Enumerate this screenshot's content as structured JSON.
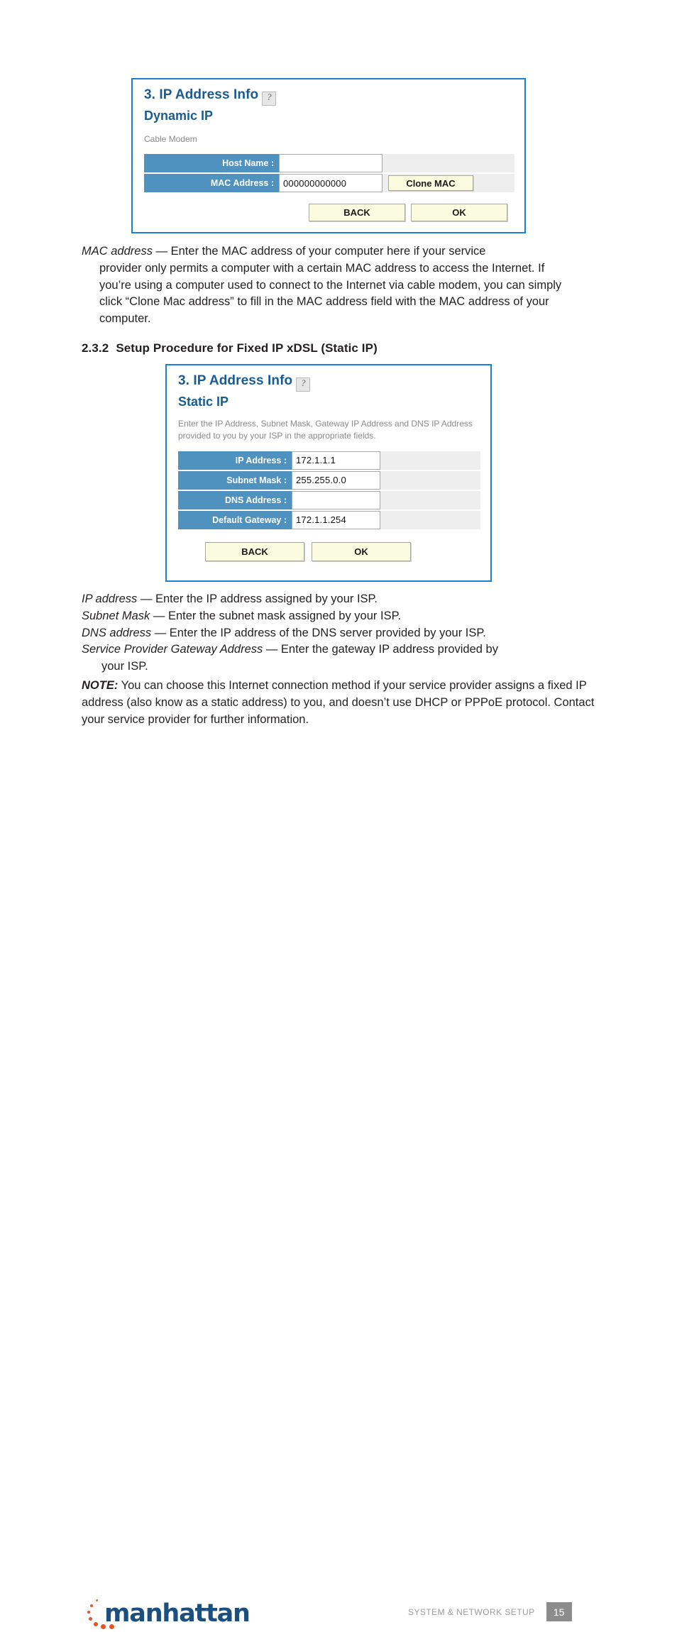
{
  "panels": [
    {
      "id": "dynamic",
      "title": "3. IP Address Info",
      "help_icon": "question-mark-icon",
      "subtitle": "Dynamic IP",
      "note": "Cable Modem",
      "rows": [
        {
          "label": "Host Name :",
          "value": "",
          "button": ""
        },
        {
          "label": "MAC Address :",
          "value": "000000000000",
          "button": "Clone MAC"
        }
      ],
      "actions": [
        "BACK",
        "OK"
      ]
    },
    {
      "id": "static",
      "title": "3. IP Address Info",
      "help_icon": "question-mark-icon",
      "subtitle": "Static IP",
      "note": "Enter the IP Address, Subnet Mask, Gateway IP Address and DNS IP Address provided to you by your ISP in the appropriate fields.",
      "rows": [
        {
          "label": "IP Address :",
          "value": "172.1.1.1"
        },
        {
          "label": "Subnet Mask :",
          "value": "255.255.0.0"
        },
        {
          "label": "DNS Address :",
          "value": ""
        },
        {
          "label": "Default Gateway :",
          "value": "172.1.1.254"
        }
      ],
      "actions": [
        "BACK",
        "OK"
      ]
    }
  ],
  "paragraph_mac": {
    "term": "MAC address",
    "dash": " — ",
    "line1": "Enter the MAC address of your computer here if your service",
    "rest": "provider only permits a computer with a certain MAC address to access the Internet. If you’re using a computer used to connect to the Internet via cable modem, you can simply click “Clone Mac address” to fill in the MAC address field with the MAC address of your computer."
  },
  "heading": {
    "number": "2.3.2",
    "text": "Setup Procedure for Fixed IP xDSL (Static IP)"
  },
  "definitions": [
    {
      "term": "IP address",
      "dash": " — ",
      "text": "Enter the IP address assigned by your ISP."
    },
    {
      "term": "Subnet Mask",
      "dash": " — ",
      "text": "Enter the subnet mask assigned by your ISP."
    },
    {
      "term": "DNS address",
      "dash": " — ",
      "text": "Enter the IP address of the DNS server provided by your ISP."
    },
    {
      "term": "Service Provider Gateway Address ",
      "dash": " — ",
      "text": "Enter the gateway IP address provided by",
      "continuation": "your ISP."
    }
  ],
  "note_block": {
    "label": "NOTE:",
    "text": " You can choose this Internet connection method if your service provider assigns a fixed IP address (also know as a static address) to you, and doesn’t use DHCP or PPPoE protocol. Contact your service provider for further information."
  },
  "footer": {
    "logo_text": "manhattan",
    "section_title": "SYSTEM & NETWORK SETUP",
    "page_number": "15"
  },
  "colors": {
    "panel_border": "#1b7fd4",
    "panel_heading": "#1b5c90",
    "row_label_bg": "#4f91bf",
    "button_bg": "#fbfbe0",
    "logo_blue": "#1b4f80",
    "logo_orange": "#e8541f",
    "page_badge_bg": "#8c8c8c"
  }
}
